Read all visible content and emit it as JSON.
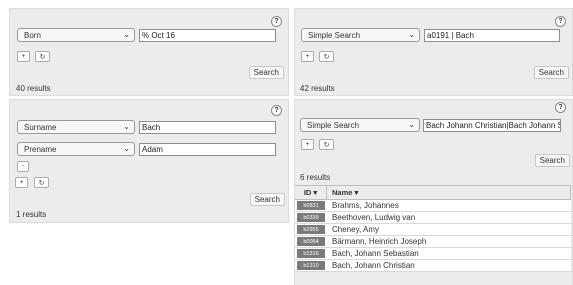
{
  "help_label": "?",
  "panel1": {
    "field": "Born",
    "value": "% Oct 16",
    "add": "+",
    "reset": "↻",
    "search": "Search",
    "results": "40 results"
  },
  "panel2": {
    "field": "Simple Search",
    "value": "a0191 | Bach",
    "add": "+",
    "reset": "↻",
    "search": "Search",
    "results": "42 results"
  },
  "panel3": {
    "rows": [
      {
        "field": "Surname",
        "value": "Bach"
      },
      {
        "field": "Prename",
        "value": "Adam"
      }
    ],
    "remove": "-",
    "add": "+",
    "reset": "↻",
    "search": "Search",
    "results": "1 results"
  },
  "panel4": {
    "field": "Simple Search",
    "value": "Bach Johann Christian|Bach Johann Seb",
    "add": "+",
    "reset": "↻",
    "search": "Search",
    "results": "6 results",
    "columns": {
      "id": "ID ▾",
      "name": "Name ▾"
    },
    "rows": [
      {
        "id": "b0831",
        "name": "Brahms, Johannes"
      },
      {
        "id": "b0339",
        "name": "Beethoven, Ludwig van"
      },
      {
        "id": "b2955",
        "name": "Cheney, Amy"
      },
      {
        "id": "b0064",
        "name": "Bärmann, Heinrich Joseph"
      },
      {
        "id": "b1316",
        "name": "Bach, Johann Sebastian"
      },
      {
        "id": "b1310",
        "name": "Bach, Johann Christian"
      }
    ]
  },
  "icons": {
    "chevron": "chevron-down-icon",
    "reset": "refresh-icon",
    "add": "plus-icon",
    "remove": "minus-icon",
    "help": "help-icon"
  }
}
